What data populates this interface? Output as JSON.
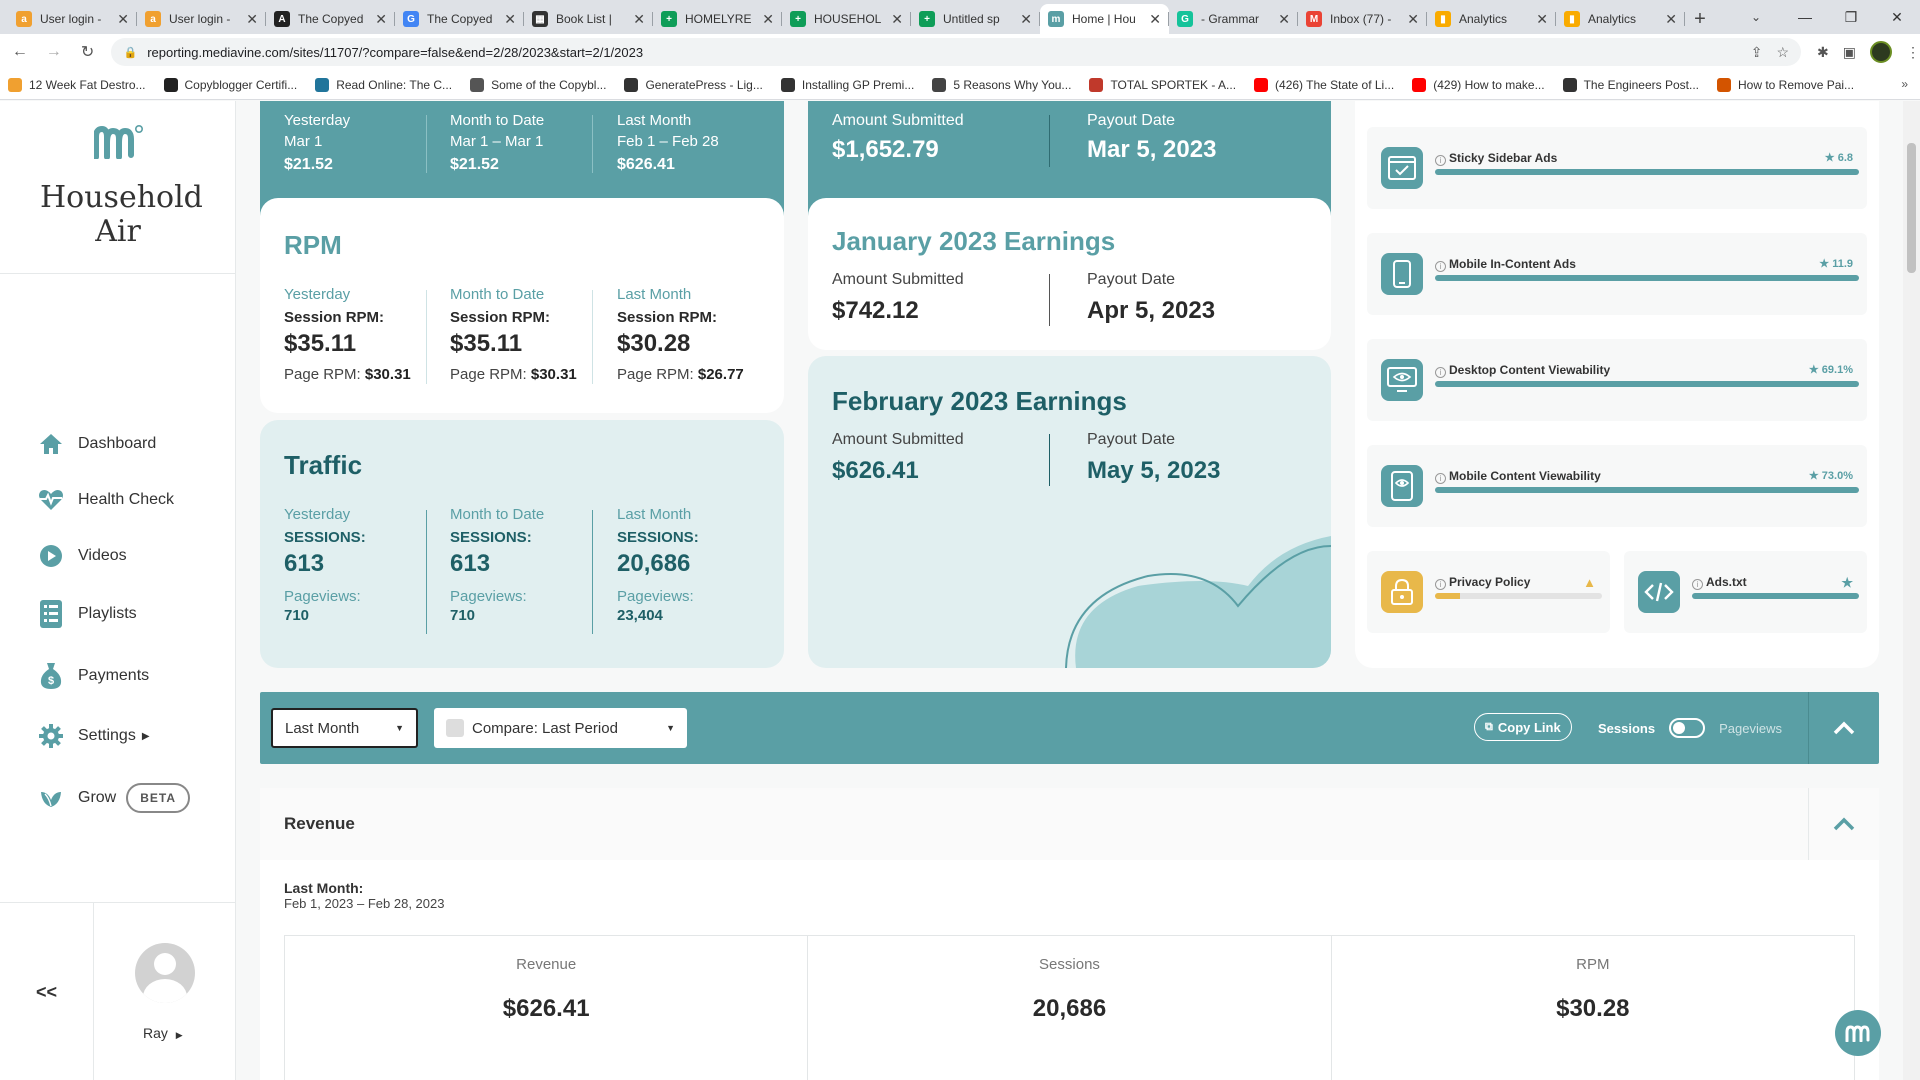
{
  "browser": {
    "tabs": [
      {
        "title": "User login -",
        "fav_color": "#f0a030",
        "fav_glyph": "a"
      },
      {
        "title": "User login -",
        "fav_color": "#f0a030",
        "fav_glyph": "a"
      },
      {
        "title": "The Copyed",
        "fav_color": "#222222",
        "fav_glyph": "A"
      },
      {
        "title": "The Copyed",
        "fav_color": "#4285f4",
        "fav_glyph": "G"
      },
      {
        "title": "Book List |",
        "fav_color": "#333333",
        "fav_glyph": "▦"
      },
      {
        "title": "HOMELYRE",
        "fav_color": "#0f9d58",
        "fav_glyph": "+"
      },
      {
        "title": "HOUSEHOL",
        "fav_color": "#0f9d58",
        "fav_glyph": "+"
      },
      {
        "title": "Untitled sp",
        "fav_color": "#0f9d58",
        "fav_glyph": "+"
      },
      {
        "title": "Home | Hou",
        "fav_color": "#5a9fa5",
        "fav_glyph": "m",
        "active": true
      },
      {
        "title": "- Grammar",
        "fav_color": "#15c39a",
        "fav_glyph": "G"
      },
      {
        "title": "Inbox (77) -",
        "fav_color": "#ea4335",
        "fav_glyph": "M"
      },
      {
        "title": "Analytics",
        "fav_color": "#f9ab00",
        "fav_glyph": "▮"
      },
      {
        "title": "Analytics",
        "fav_color": "#f9ab00",
        "fav_glyph": "▮"
      }
    ],
    "url": "reporting.mediavine.com/sites/11707/?compare=false&end=2/28/2023&start=2/1/2023",
    "bookmarks": [
      {
        "label": "12 Week Fat Destro...",
        "color": "#f0a030"
      },
      {
        "label": "Copyblogger Certifi...",
        "color": "#222222"
      },
      {
        "label": "Read Online: The C...",
        "color": "#21759b"
      },
      {
        "label": "Some of the Copybl...",
        "color": "#555555"
      },
      {
        "label": "GeneratePress - Lig...",
        "color": "#333333"
      },
      {
        "label": "Installing GP Premi...",
        "color": "#333333"
      },
      {
        "label": "5 Reasons Why You...",
        "color": "#444444"
      },
      {
        "label": "TOTAL SPORTEK - A...",
        "color": "#c0392b"
      },
      {
        "label": "(426) The State of Li...",
        "color": "#ff0000"
      },
      {
        "label": "(429) How to make...",
        "color": "#ff0000"
      },
      {
        "label": "The Engineers Post...",
        "color": "#333333"
      },
      {
        "label": "How to Remove Pai...",
        "color": "#d35400"
      }
    ]
  },
  "sidebar": {
    "site_name": "Household Air",
    "nav": [
      {
        "label": "Dashboard",
        "icon": "home-icon"
      },
      {
        "label": "Health Check",
        "icon": "heartbeat-icon"
      },
      {
        "label": "Videos",
        "icon": "play-icon"
      },
      {
        "label": "Playlists",
        "icon": "list-icon"
      },
      {
        "label": "Payments",
        "icon": "money-bag-icon"
      },
      {
        "label": "Settings",
        "icon": "gear-icon"
      },
      {
        "label": "Grow",
        "icon": "leaf-icon",
        "badge": "BETA"
      }
    ],
    "collapse_label": "<<",
    "user_name": "Ray"
  },
  "revenue_top": {
    "cols": [
      {
        "label": "Yesterday",
        "date": "Mar 1",
        "amount": "$21.52"
      },
      {
        "label": "Month to Date",
        "date": "Mar 1 – Mar 1",
        "amount": "$21.52"
      },
      {
        "label": "Last Month",
        "date": "Feb 1 – Feb 28",
        "amount": "$626.41"
      }
    ]
  },
  "current_earnings": {
    "amount_label": "Amount Submitted",
    "amount": "$1,652.79",
    "payout_label": "Payout Date",
    "payout": "Mar 5, 2023"
  },
  "rpm": {
    "title": "RPM",
    "cols": [
      {
        "label": "Yesterday",
        "session_label": "Session RPM:",
        "session": "$35.11",
        "page_label": "Page RPM:",
        "page": "$30.31"
      },
      {
        "label": "Month to Date",
        "session_label": "Session RPM:",
        "session": "$35.11",
        "page_label": "Page RPM:",
        "page": "$30.31"
      },
      {
        "label": "Last Month",
        "session_label": "Session RPM:",
        "session": "$30.28",
        "page_label": "Page RPM:",
        "page": "$26.77"
      }
    ]
  },
  "traffic": {
    "title": "Traffic",
    "cols": [
      {
        "label": "Yesterday",
        "sessions_label": "SESSIONS:",
        "sessions": "613",
        "pageviews_label": "Pageviews:",
        "pageviews": "710"
      },
      {
        "label": "Month to Date",
        "sessions_label": "SESSIONS:",
        "sessions": "613",
        "pageviews_label": "Pageviews:",
        "pageviews": "710"
      },
      {
        "label": "Last Month",
        "sessions_label": "SESSIONS:",
        "sessions": "20,686",
        "pageviews_label": "Pageviews:",
        "pageviews": "23,404"
      }
    ]
  },
  "jan_earnings": {
    "title": "January 2023 Earnings",
    "amount_label": "Amount Submitted",
    "amount": "$742.12",
    "payout_label": "Payout Date",
    "payout": "Apr 5, 2023"
  },
  "feb_earnings": {
    "title": "February 2023 Earnings",
    "amount_label": "Amount Submitted",
    "amount": "$626.41",
    "payout_label": "Payout Date",
    "payout": "May 5, 2023"
  },
  "health": {
    "items": [
      {
        "name": "Sticky Sidebar Ads",
        "score": "6.8",
        "icon": "browser-check-icon"
      },
      {
        "name": "Mobile In-Content Ads",
        "score": "11.9",
        "icon": "mobile-icon"
      },
      {
        "name": "Desktop Content Viewability",
        "score": "69.1%",
        "icon": "desktop-eye-icon"
      },
      {
        "name": "Mobile Content Viewability",
        "score": "73.0%",
        "icon": "mobile-eye-icon"
      }
    ],
    "privacy": {
      "name": "Privacy Policy",
      "icon": "lock-icon",
      "fill": 0.15
    },
    "adstxt": {
      "name": "Ads.txt",
      "icon": "code-icon"
    }
  },
  "filters": {
    "range": "Last Month",
    "compare": "Compare: Last Period",
    "copy_link": "Copy Link",
    "toggle_left": "Sessions",
    "toggle_right": "Pageviews"
  },
  "revenue_panel": {
    "title": "Revenue",
    "period_label": "Last Month:",
    "period_dates": "Feb 1, 2023 – Feb 28, 2023",
    "stats": [
      {
        "label": "Revenue",
        "value": "$626.41"
      },
      {
        "label": "Sessions",
        "value": "20,686"
      },
      {
        "label": "RPM",
        "value": "$30.28"
      }
    ]
  },
  "colors": {
    "accent": "#5a9fa5",
    "warning": "#e8b84a"
  }
}
